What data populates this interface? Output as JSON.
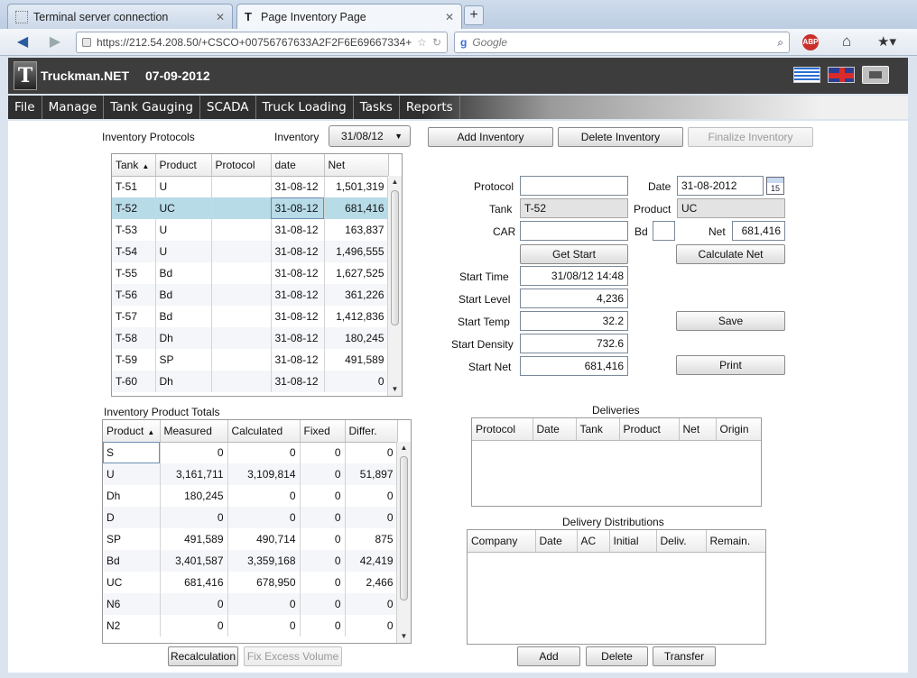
{
  "browser": {
    "tabs": [
      {
        "label": "Terminal server connection"
      },
      {
        "label": "Page Inventory Page"
      }
    ],
    "new_tab": "+",
    "url": "https://212.54.208.50/+CSCO+00756767633A2F2F6E69667334+",
    "search_placeholder": "Google",
    "adblock": "ABP"
  },
  "app": {
    "logo_letter": "T",
    "title": "Truckman.NET",
    "date": "07-09-2012"
  },
  "menu": [
    "File",
    "Manage",
    "Tank Gauging",
    "SCADA",
    "Truck Loading",
    "Tasks",
    "Reports"
  ],
  "protocols": {
    "title": "Inventory Protocols",
    "inventory_label": "Inventory",
    "inventory_value": "31/08/12",
    "columns": [
      "Tank",
      "Product",
      "Protocol",
      "date",
      "Net"
    ],
    "rows": [
      [
        "T-51",
        "U",
        "",
        "31-08-12",
        "1,501,319"
      ],
      [
        "T-52",
        "UC",
        "",
        "31-08-12",
        "681,416"
      ],
      [
        "T-53",
        "U",
        "",
        "31-08-12",
        "163,837"
      ],
      [
        "T-54",
        "U",
        "",
        "31-08-12",
        "1,496,555"
      ],
      [
        "T-55",
        "Bd",
        "",
        "31-08-12",
        "1,627,525"
      ],
      [
        "T-56",
        "Bd",
        "",
        "31-08-12",
        "361,226"
      ],
      [
        "T-57",
        "Bd",
        "",
        "31-08-12",
        "1,412,836"
      ],
      [
        "T-58",
        "Dh",
        "",
        "31-08-12",
        "180,245"
      ],
      [
        "T-59",
        "SP",
        "",
        "31-08-12",
        "491,589"
      ],
      [
        "T-60",
        "Dh",
        "",
        "31-08-12",
        "0"
      ]
    ]
  },
  "actions": {
    "add_inventory": "Add Inventory",
    "delete_inventory": "Delete Inventory",
    "finalize_inventory": "Finalize Inventory"
  },
  "form": {
    "protocol_label": "Protocol",
    "protocol_value": "",
    "date_label": "Date",
    "date_value": "31-08-2012",
    "calendar_day": "15",
    "tank_label": "Tank",
    "tank_value": "T-52",
    "product_label": "Product",
    "product_value": "UC",
    "car_label": "CAR",
    "car_value": "",
    "bd_label": "Bd",
    "bd_value": "",
    "net_label": "Net",
    "net_value": "681,416",
    "get_start": "Get Start",
    "calculate_net": "Calculate Net",
    "start_time_label": "Start Time",
    "start_time_value": "31/08/12 14:48",
    "start_level_label": "Start Level",
    "start_level_value": "4,236",
    "start_temp_label": "Start Temp",
    "start_temp_value": "32.2",
    "start_density_label": "Start Density",
    "start_density_value": "732.6",
    "start_net_label": "Start Net",
    "start_net_value": "681,416",
    "save": "Save",
    "print": "Print"
  },
  "totals": {
    "title": "Inventory Product Totals",
    "columns": [
      "Product",
      "Measured",
      "Calculated",
      "Fixed",
      "Differ."
    ],
    "rows": [
      [
        "S",
        "0",
        "0",
        "0",
        "0"
      ],
      [
        "U",
        "3,161,711",
        "3,109,814",
        "0",
        "51,897"
      ],
      [
        "Dh",
        "180,245",
        "0",
        "0",
        "0"
      ],
      [
        "D",
        "0",
        "0",
        "0",
        "0"
      ],
      [
        "SP",
        "491,589",
        "490,714",
        "0",
        "875"
      ],
      [
        "Bd",
        "3,401,587",
        "3,359,168",
        "0",
        "42,419"
      ],
      [
        "UC",
        "681,416",
        "678,950",
        "0",
        "2,466"
      ],
      [
        "N6",
        "0",
        "0",
        "0",
        "0"
      ],
      [
        "N2",
        "0",
        "0",
        "0",
        "0"
      ]
    ],
    "recalculation": "Recalculation",
    "fix_excess": "Fix Excess Volume"
  },
  "deliveries": {
    "title": "Deliveries",
    "columns": [
      "Protocol",
      "Date",
      "Tank",
      "Product",
      "Net",
      "Origin"
    ]
  },
  "distributions": {
    "title": "Delivery Distributions",
    "columns": [
      "Company",
      "Date",
      "AC",
      "Initial",
      "Deliv.",
      "Remain."
    ],
    "add": "Add",
    "delete": "Delete",
    "transfer": "Transfer"
  }
}
